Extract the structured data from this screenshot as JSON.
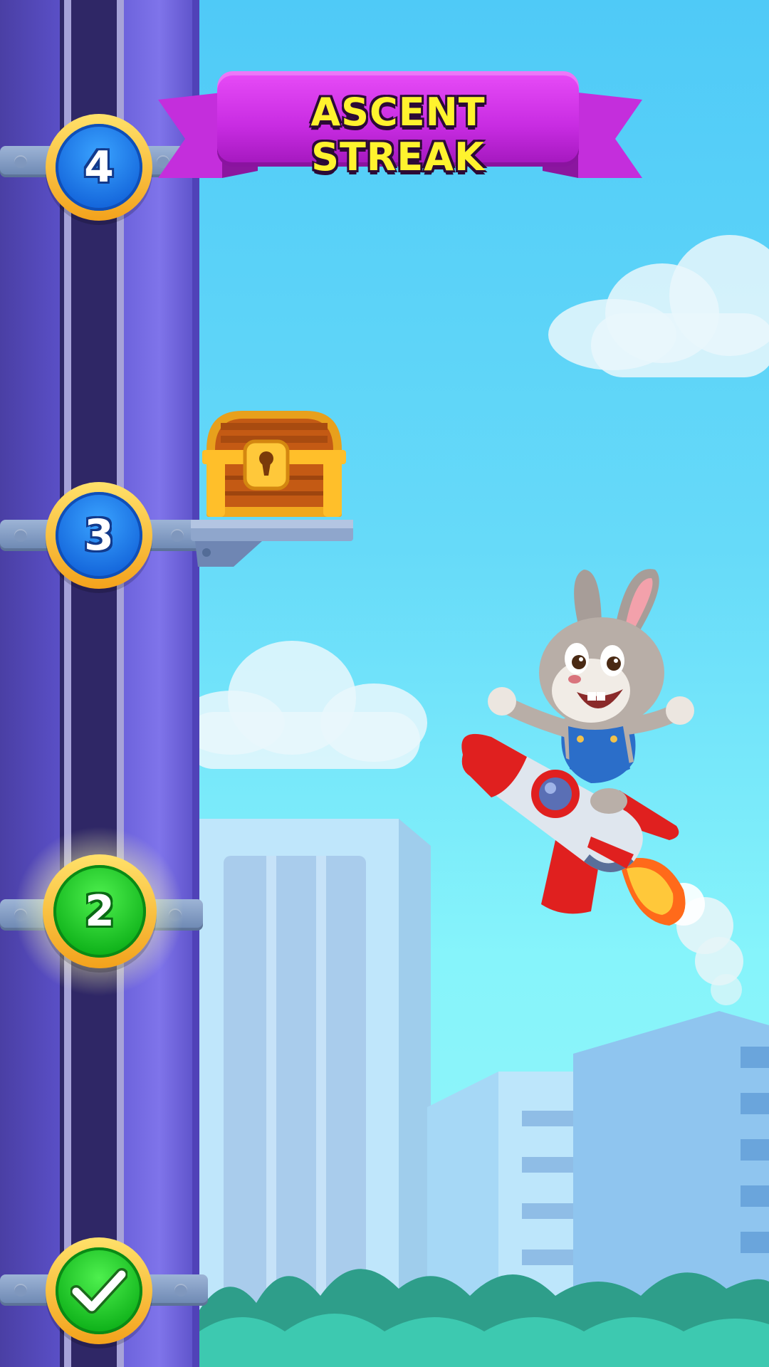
{
  "banner": {
    "title": "ASCENT STREAK"
  },
  "levels": [
    {
      "label": "4",
      "state": "locked"
    },
    {
      "label": "3",
      "state": "locked"
    },
    {
      "label": "2",
      "state": "current"
    },
    {
      "label": "",
      "state": "completed"
    }
  ],
  "reward": {
    "icon": "treasure-chest-icon",
    "at_level": "3"
  },
  "character": {
    "icon": "bunny-on-rocket"
  },
  "colors": {
    "sky": "#5fd3f8",
    "tower": "#5a4fc6",
    "banner": "#d13ae8",
    "banner_text": "#fff32e",
    "node_blue": "#1c6fe0",
    "node_green": "#18c022",
    "node_ring": "#f7b52c"
  }
}
